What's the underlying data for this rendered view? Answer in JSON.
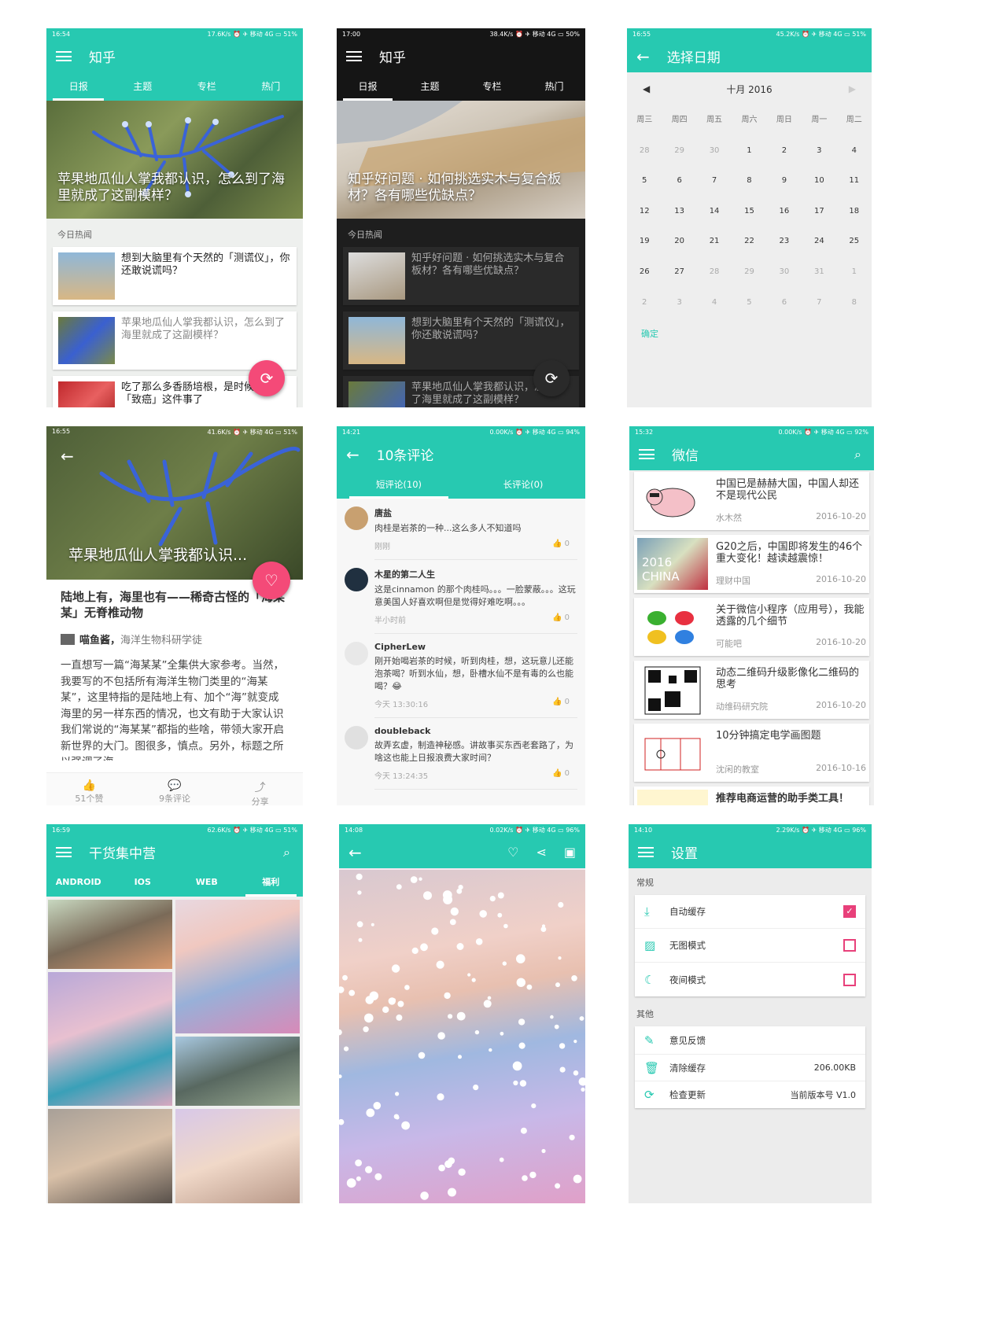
{
  "colors": {
    "teal": "#27c9b1",
    "pink": "#f44a78",
    "dark": "#1e1e1e"
  },
  "p1": {
    "status": {
      "time": "16:54",
      "right": "17.6K/s ⏰ ✈ 移动 4G ▭ 51%"
    },
    "title": "知乎",
    "tabs": [
      "日报",
      "主题",
      "专栏",
      "热门"
    ],
    "hero_caption": "苹果地瓜仙人掌我都认识，怎么到了海里就成了这副模样？",
    "section": "今日热闻",
    "items": [
      "想到大脑里有个天然的「测谎仪」，你还敢说谎吗？",
      "苹果地瓜仙人掌我都认识，怎么到了海里就成了这副模样？",
      "吃了那么多香肠培根，是时候聊聊「致癌」这件事了"
    ]
  },
  "p2": {
    "status": {
      "time": "17:00",
      "right": "38.4K/s ⏰ ✈ 移动 4G ▭ 50%"
    },
    "title": "知乎",
    "tabs": [
      "日报",
      "主题",
      "专栏",
      "热门"
    ],
    "hero_caption": "知乎好问题 · 如何挑选实木与复合板材？各有哪些优缺点？",
    "section": "今日热闻",
    "items": [
      "知乎好问题 · 如何挑选实木与复合板材？各有哪些优缺点？",
      "想到大脑里有个天然的「测谎仪」，你还敢说谎吗？",
      "苹果地瓜仙人掌我都认识，怎么到了海里就成了这副模样？"
    ]
  },
  "p3": {
    "status": {
      "time": "16:55",
      "right": "45.2K/s ⏰ ✈ 移动 4G ▭ 51%"
    },
    "title": "选择日期",
    "month": "十月 2016",
    "weekdays": [
      "周三",
      "周四",
      "周五",
      "周六",
      "周日",
      "周一",
      "周二"
    ],
    "days": [
      [
        "28",
        "29",
        "30",
        "1",
        "2",
        "3",
        "4"
      ],
      [
        "5",
        "6",
        "7",
        "8",
        "9",
        "10",
        "11"
      ],
      [
        "12",
        "13",
        "14",
        "15",
        "16",
        "17",
        "18"
      ],
      [
        "19",
        "20",
        "21",
        "22",
        "23",
        "24",
        "25"
      ],
      [
        "26",
        "27",
        "28",
        "29",
        "30",
        "31",
        "1"
      ],
      [
        "2",
        "3",
        "4",
        "5",
        "6",
        "7",
        "8"
      ]
    ],
    "ok": "确定"
  },
  "p4": {
    "status": {
      "time": "16:55",
      "right": "41.6K/s ⏰ ✈ 移动 4G ▭ 51%"
    },
    "hero_caption": "苹果地瓜仙人掌我都认识...",
    "title": "陆地上有，海里也有——稀奇古怪的「海某某」无脊椎动物",
    "author": "喵鱼酱，",
    "author_desc": "海洋生物科研学徒",
    "body": "一直想写一篇“海某某”全集供大家参考。当然，我要写的不包括所有海洋生物门类里的“海某某”，这里特指的是陆地上有、加个“海”就变成海里的另一样东西的情况，也文有助于大家认识我们常说的“海某某”都指的些啥，带领大家开启新世界的大门。图很多，慎点。另外，标题之所以强调了海",
    "actions": [
      "51个赞",
      "9条评论",
      "分享"
    ]
  },
  "p5": {
    "status": {
      "time": "14:21",
      "right": "0.00K/s ⏰ ✈ 移动 4G ▭ 94%"
    },
    "title": "10条评论",
    "tabs": [
      "短评论(10)",
      "长评论(0)"
    ],
    "comments": [
      {
        "name": "唐盐",
        "text": "肉桂是岩茶的一种...这么多人不知道吗",
        "time": "刚刚",
        "likes": "0"
      },
      {
        "name": "木星的第二人生",
        "text": "这是cinnamon 的那个肉桂吗。。。一脸蒙蔽。。。这玩意美国人好喜欢啊但是觉得好难吃啊。。。",
        "time": "半小时前",
        "likes": "0"
      },
      {
        "name": "CipherLew",
        "text": "刚开始喝岩茶的时候，听到肉桂，想，这玩意儿还能泡茶喝？听到水仙，想，卧槽水仙不是有毒的么也能喝？😂",
        "time": "今天 13:30:16",
        "likes": "0"
      },
      {
        "name": "doubleback",
        "text": "故弄玄虚，制造神秘感。讲故事买东西老套路了，为啥这也能上日报浪费大家时间？",
        "time": "今天 13:24:35",
        "likes": "0"
      }
    ]
  },
  "p6": {
    "status": {
      "time": "15:32",
      "right": "0.00K/s ⏰ ✈ 移动 4G ▭ 92%"
    },
    "title": "微信",
    "items": [
      {
        "title": "中国已是赫赫大国，中国人却还不是现代公民",
        "src": "水木然",
        "date": "2016-10-20"
      },
      {
        "title": "G20之后，中国即将发生的46个重大变化！越读越震惊！",
        "src": "理财中国",
        "date": "2016-10-20"
      },
      {
        "title": "关于微信小程序（应用号），我能透露的几个细节",
        "src": "可能吧",
        "date": "2016-10-20"
      },
      {
        "title": "动态二维码升级影像化二维码的思考",
        "src": "动维码研究院",
        "date": "2016-10-20"
      },
      {
        "title": "10分钟搞定电学画图题",
        "src": "沈闲的教室",
        "date": "2016-10-16"
      }
    ],
    "last": "推荐电商运营的助手类工具！",
    "thumb_text": "2016 CHINA"
  },
  "p7": {
    "status": {
      "time": "16:59",
      "right": "62.6K/s ⏰ ✈ 移动 4G ▭ 51%"
    },
    "title": "干货集中营",
    "tabs": [
      "ANDROID",
      "IOS",
      "WEB",
      "福利"
    ]
  },
  "p8": {
    "status": {
      "time": "14:08",
      "right": "0.02K/s ⏰ ✈ 移动 4G ▭ 96%"
    }
  },
  "p9": {
    "status": {
      "time": "14:10",
      "right": "2.29K/s ⏰ ✈ 移动 4G ▭ 96%"
    },
    "title": "设置",
    "group1": "常规",
    "rows1": [
      "自动缓存",
      "无图模式",
      "夜间模式"
    ],
    "group2": "其他",
    "rows2": [
      "意见反馈",
      "清除缓存",
      "检查更新"
    ],
    "cache_size": "206.00KB",
    "version": "当前版本号 V1.0"
  }
}
